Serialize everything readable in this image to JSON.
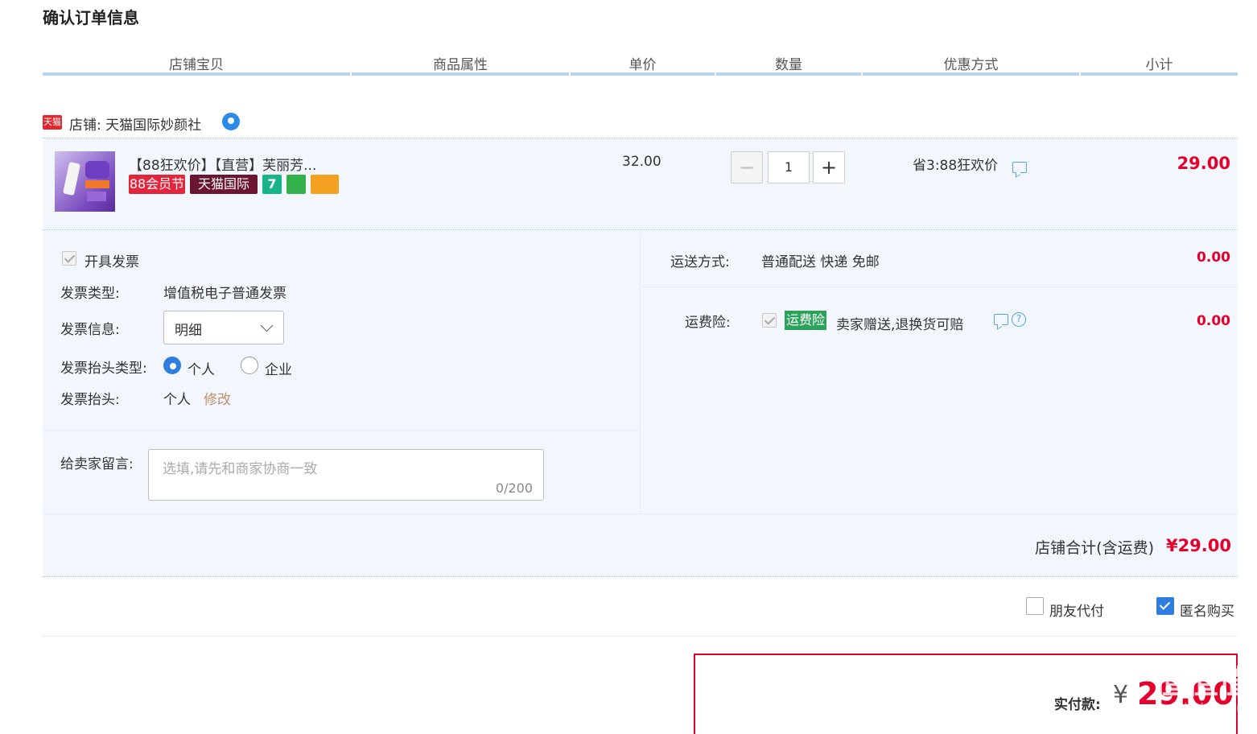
{
  "page_title": "确认订单信息",
  "columns": [
    "店铺宝贝",
    "商品属性",
    "单价",
    "数量",
    "优惠方式",
    "小计"
  ],
  "shop": {
    "badge": "天猫",
    "label": "店铺: 天猫国际妙颜社"
  },
  "product": {
    "title": "【88狂欢价】【直营】芙丽芳...",
    "badges": [
      "88会员节",
      "天猫国际",
      "7",
      "",
      ""
    ],
    "unit_price": "32.00",
    "quantity": "1",
    "promo": "省3:88狂欢价",
    "subtotal": "29.00"
  },
  "invoice": {
    "checkbox_label": "开具发票",
    "type_label": "发票类型:",
    "type_value": "增值税电子普通发票",
    "info_label": "发票信息:",
    "info_value": "明细",
    "title_type_label": "发票抬头类型:",
    "option_personal": "个人",
    "option_company": "企业",
    "title_label": "发票抬头:",
    "title_value": "个人",
    "edit_link": "修改"
  },
  "message": {
    "label": "给卖家留言:",
    "placeholder": "选填,请先和商家协商一致",
    "counter": "0/200"
  },
  "shipping": {
    "label": "运送方式:",
    "value": "普通配送 快递 免邮",
    "fee": "0.00"
  },
  "insurance": {
    "label": "运费险:",
    "tag": "运费险",
    "desc": "卖家赠送,退换货可赔",
    "fee": "0.00"
  },
  "shop_total": {
    "label": "店铺合计(含运费)",
    "value": "¥29.00"
  },
  "options": {
    "friend_pay": "朋友代付",
    "anonymous": "匿名购买"
  },
  "payment": {
    "label": "实付款:",
    "currency": "¥",
    "value": "29.00"
  },
  "watermark": {
    "text": "值值值",
    "sub": "zhizhizhi.com"
  },
  "colors": {
    "accent_red": "#e4002b",
    "header_line": "#b7d4f3",
    "band_bg": "#f2f7fd",
    "checkbox_blue": "#2f7de1"
  }
}
